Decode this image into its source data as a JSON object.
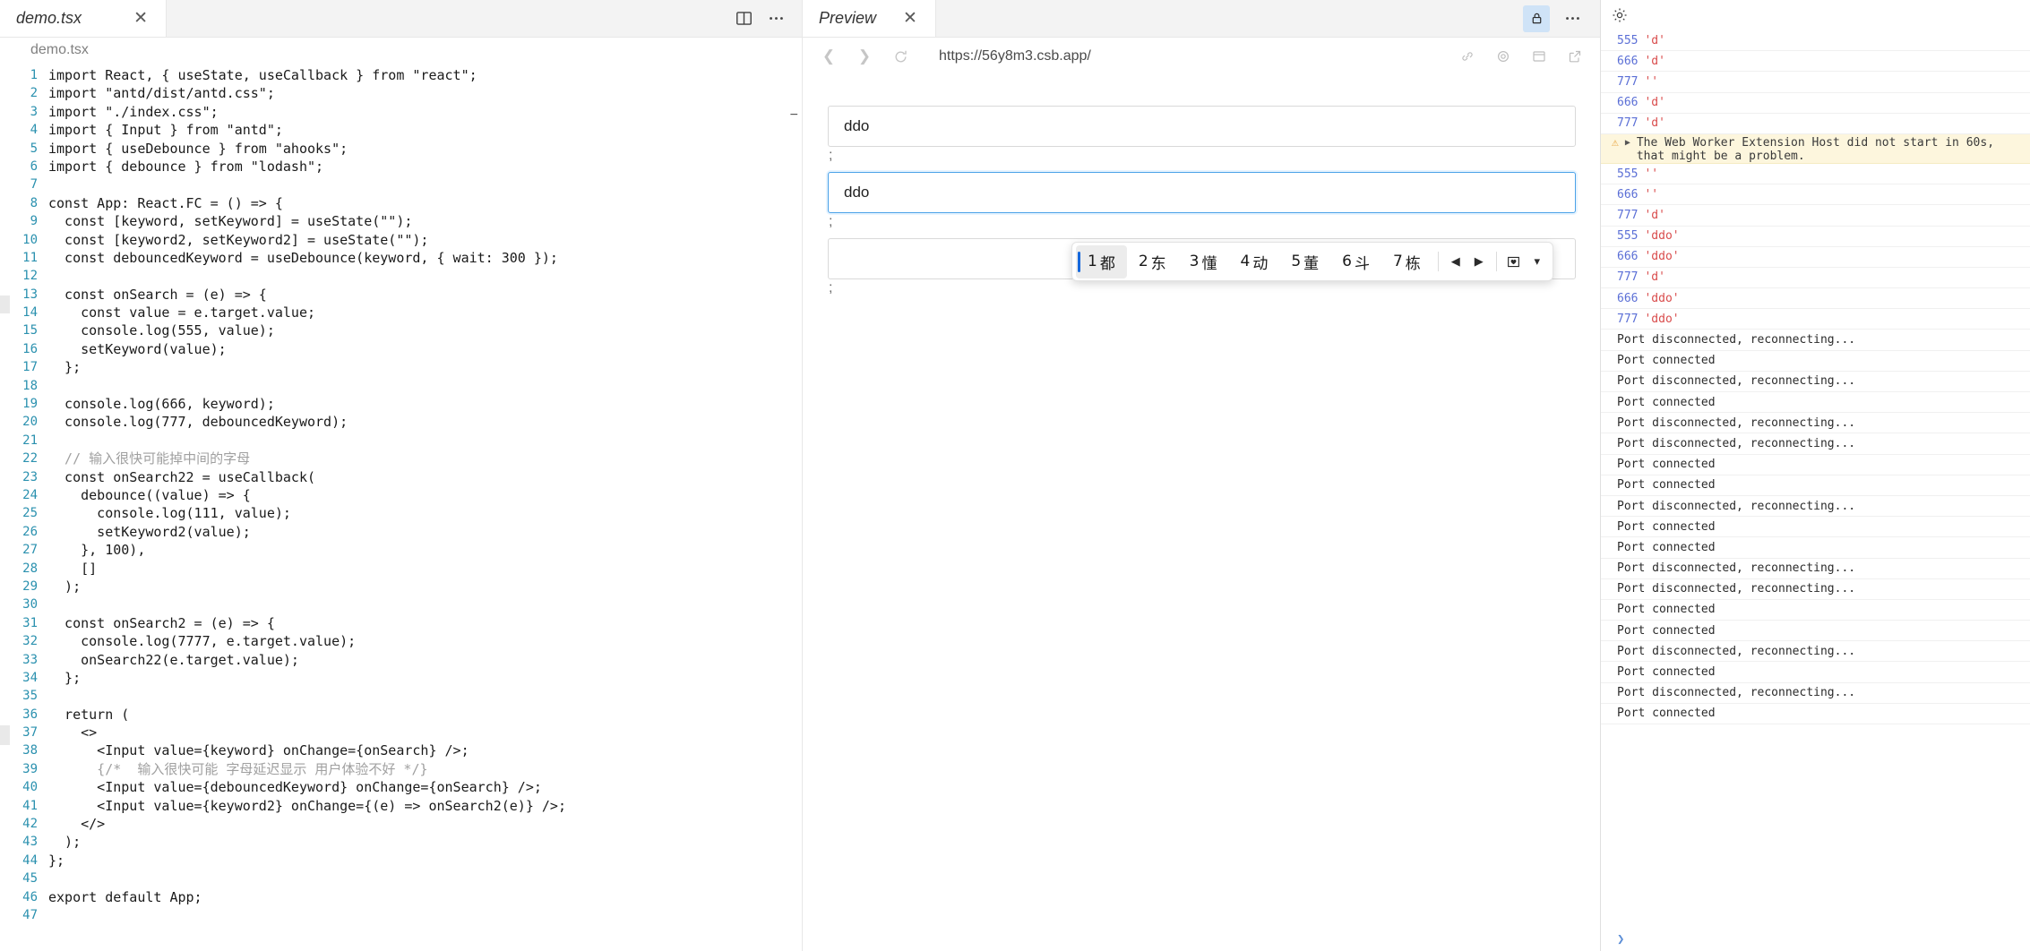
{
  "editor": {
    "tab": {
      "label": "demo.tsx",
      "close_icon": "close-icon"
    },
    "actions": {
      "split_icon": "split-editor-icon",
      "more_icon": "more-actions-icon"
    },
    "breadcrumb": "demo.tsx",
    "fold_indicator": "−",
    "lines": [
      {
        "n": "1",
        "text": "import React, { useState, useCallback } from \"react\";",
        "comment": false
      },
      {
        "n": "2",
        "text": "import \"antd/dist/antd.css\";",
        "comment": false
      },
      {
        "n": "3",
        "text": "import \"./index.css\";",
        "comment": false
      },
      {
        "n": "4",
        "text": "import { Input } from \"antd\";",
        "comment": false
      },
      {
        "n": "5",
        "text": "import { useDebounce } from \"ahooks\";",
        "comment": false
      },
      {
        "n": "6",
        "text": "import { debounce } from \"lodash\";",
        "comment": false
      },
      {
        "n": "7",
        "text": "",
        "comment": false
      },
      {
        "n": "8",
        "text": "const App: React.FC = () => {",
        "comment": false
      },
      {
        "n": "9",
        "text": "  const [keyword, setKeyword] = useState(\"\");",
        "comment": false
      },
      {
        "n": "10",
        "text": "  const [keyword2, setKeyword2] = useState(\"\");",
        "comment": false
      },
      {
        "n": "11",
        "text": "  const debouncedKeyword = useDebounce(keyword, { wait: 300 });",
        "comment": false
      },
      {
        "n": "12",
        "text": "",
        "comment": false
      },
      {
        "n": "13",
        "text": "  const onSearch = (e) => {",
        "comment": false
      },
      {
        "n": "14",
        "text": "    const value = e.target.value;",
        "comment": false
      },
      {
        "n": "15",
        "text": "    console.log(555, value);",
        "comment": false
      },
      {
        "n": "16",
        "text": "    setKeyword(value);",
        "comment": false
      },
      {
        "n": "17",
        "text": "  };",
        "comment": false
      },
      {
        "n": "18",
        "text": "",
        "comment": false
      },
      {
        "n": "19",
        "text": "  console.log(666, keyword);",
        "comment": false
      },
      {
        "n": "20",
        "text": "  console.log(777, debouncedKeyword);",
        "comment": false
      },
      {
        "n": "21",
        "text": "",
        "comment": false
      },
      {
        "n": "22",
        "text": "  // 输入很快可能掉中间的字母",
        "comment": true
      },
      {
        "n": "23",
        "text": "  const onSearch22 = useCallback(",
        "comment": false
      },
      {
        "n": "24",
        "text": "    debounce((value) => {",
        "comment": false
      },
      {
        "n": "25",
        "text": "      console.log(111, value);",
        "comment": false
      },
      {
        "n": "26",
        "text": "      setKeyword2(value);",
        "comment": false
      },
      {
        "n": "27",
        "text": "    }, 100),",
        "comment": false
      },
      {
        "n": "28",
        "text": "    []",
        "comment": false
      },
      {
        "n": "29",
        "text": "  );",
        "comment": false
      },
      {
        "n": "30",
        "text": "",
        "comment": false
      },
      {
        "n": "31",
        "text": "  const onSearch2 = (e) => {",
        "comment": false
      },
      {
        "n": "32",
        "text": "    console.log(7777, e.target.value);",
        "comment": false
      },
      {
        "n": "33",
        "text": "    onSearch22(e.target.value);",
        "comment": false
      },
      {
        "n": "34",
        "text": "  };",
        "comment": false
      },
      {
        "n": "35",
        "text": "",
        "comment": false
      },
      {
        "n": "36",
        "text": "  return (",
        "comment": false
      },
      {
        "n": "37",
        "text": "    <>",
        "comment": false
      },
      {
        "n": "38",
        "text": "      <Input value={keyword} onChange={onSearch} />;",
        "comment": false
      },
      {
        "n": "39",
        "text": "      {/*  输入很快可能 字母延迟显示 用户体验不好 */}",
        "comment": true
      },
      {
        "n": "40",
        "text": "      <Input value={debouncedKeyword} onChange={onSearch} />;",
        "comment": false
      },
      {
        "n": "41",
        "text": "      <Input value={keyword2} onChange={(e) => onSearch2(e)} />;",
        "comment": false
      },
      {
        "n": "42",
        "text": "    </>",
        "comment": false
      },
      {
        "n": "43",
        "text": "  );",
        "comment": false
      },
      {
        "n": "44",
        "text": "};",
        "comment": false
      },
      {
        "n": "45",
        "text": "",
        "comment": false
      },
      {
        "n": "46",
        "text": "export default App;",
        "comment": false
      },
      {
        "n": "47",
        "text": "",
        "comment": false
      }
    ]
  },
  "preview": {
    "tab": {
      "label": "Preview",
      "close_icon": "close-icon"
    },
    "actions": {
      "lock_icon": "lock-icon",
      "more_icon": "more-actions-icon"
    },
    "address": {
      "back_icon": "chevron-left-icon",
      "forward_icon": "chevron-right-icon",
      "reload_icon": "reload-icon",
      "url": "https://56y8m3.csb.app/",
      "right_icons": [
        "link-icon",
        "settings-icon",
        "devtools-icon",
        "open-external-icon"
      ]
    },
    "inputs": [
      {
        "value": "ddo",
        "placeholder": "",
        "focused": false
      },
      {
        "value": "ddo",
        "placeholder": "",
        "focused": true
      },
      {
        "value": "",
        "placeholder": "",
        "focused": false
      }
    ],
    "separators": [
      ";",
      ";",
      ";"
    ],
    "ime": {
      "candidates": [
        {
          "num": "1",
          "word": "都",
          "selected": true
        },
        {
          "num": "2",
          "word": "东",
          "selected": false
        },
        {
          "num": "3",
          "word": "懂",
          "selected": false
        },
        {
          "num": "4",
          "word": "动",
          "selected": false
        },
        {
          "num": "5",
          "word": "董",
          "selected": false
        },
        {
          "num": "6",
          "word": "斗",
          "selected": false
        },
        {
          "num": "7",
          "word": "栋",
          "selected": false
        }
      ],
      "prev_icon": "triangle-left-icon",
      "next_icon": "triangle-right-icon",
      "favorite_icon": "heart-box-icon",
      "expand_icon": "chevron-down-icon"
    }
  },
  "console": {
    "gear_icon": "gear-icon",
    "prompt": "❯",
    "entries": [
      {
        "kind": "log",
        "num": "555",
        "str": "'d'"
      },
      {
        "kind": "log",
        "num": "666",
        "str": "'d'"
      },
      {
        "kind": "log",
        "num": "777",
        "str": "''"
      },
      {
        "kind": "log",
        "num": "666",
        "str": "'d'"
      },
      {
        "kind": "log",
        "num": "777",
        "str": "'d'"
      },
      {
        "kind": "warning",
        "icon": "warning-icon",
        "caret": "▶",
        "text": "The Web Worker Extension Host did not start in 60s, that might be a problem."
      },
      {
        "kind": "log",
        "num": "555",
        "str": "''"
      },
      {
        "kind": "log",
        "num": "666",
        "str": "''"
      },
      {
        "kind": "log",
        "num": "777",
        "str": "'d'"
      },
      {
        "kind": "log",
        "num": "555",
        "str": "'ddo'"
      },
      {
        "kind": "log",
        "num": "666",
        "str": "'ddo'"
      },
      {
        "kind": "log",
        "num": "777",
        "str": "'d'"
      },
      {
        "kind": "log",
        "num": "666",
        "str": "'ddo'"
      },
      {
        "kind": "log",
        "num": "777",
        "str": "'ddo'"
      },
      {
        "kind": "plain",
        "text": "Port disconnected, reconnecting..."
      },
      {
        "kind": "plain",
        "text": "Port connected"
      },
      {
        "kind": "plain",
        "text": "Port disconnected, reconnecting..."
      },
      {
        "kind": "plain",
        "text": "Port connected"
      },
      {
        "kind": "plain",
        "text": "Port disconnected, reconnecting..."
      },
      {
        "kind": "plain",
        "text": "Port disconnected, reconnecting..."
      },
      {
        "kind": "plain",
        "text": "Port connected"
      },
      {
        "kind": "plain",
        "text": "Port connected"
      },
      {
        "kind": "plain",
        "text": "Port disconnected, reconnecting..."
      },
      {
        "kind": "plain",
        "text": "Port connected"
      },
      {
        "kind": "plain",
        "text": "Port connected"
      },
      {
        "kind": "plain",
        "text": "Port disconnected, reconnecting..."
      },
      {
        "kind": "plain",
        "text": "Port disconnected, reconnecting..."
      },
      {
        "kind": "plain",
        "text": "Port connected"
      },
      {
        "kind": "plain",
        "text": "Port connected"
      },
      {
        "kind": "plain",
        "text": "Port disconnected, reconnecting..."
      },
      {
        "kind": "plain",
        "text": "Port connected"
      },
      {
        "kind": "plain",
        "text": "Port disconnected, reconnecting..."
      },
      {
        "kind": "plain",
        "text": "Port connected"
      }
    ]
  },
  "colors": {
    "accent": "#1668dc",
    "warning_bg": "#fdf6dd",
    "log_num": "#5b6fd6",
    "log_str": "#d94c4c",
    "linenum": "#2b91af",
    "focus_border": "#4ba2e8"
  }
}
